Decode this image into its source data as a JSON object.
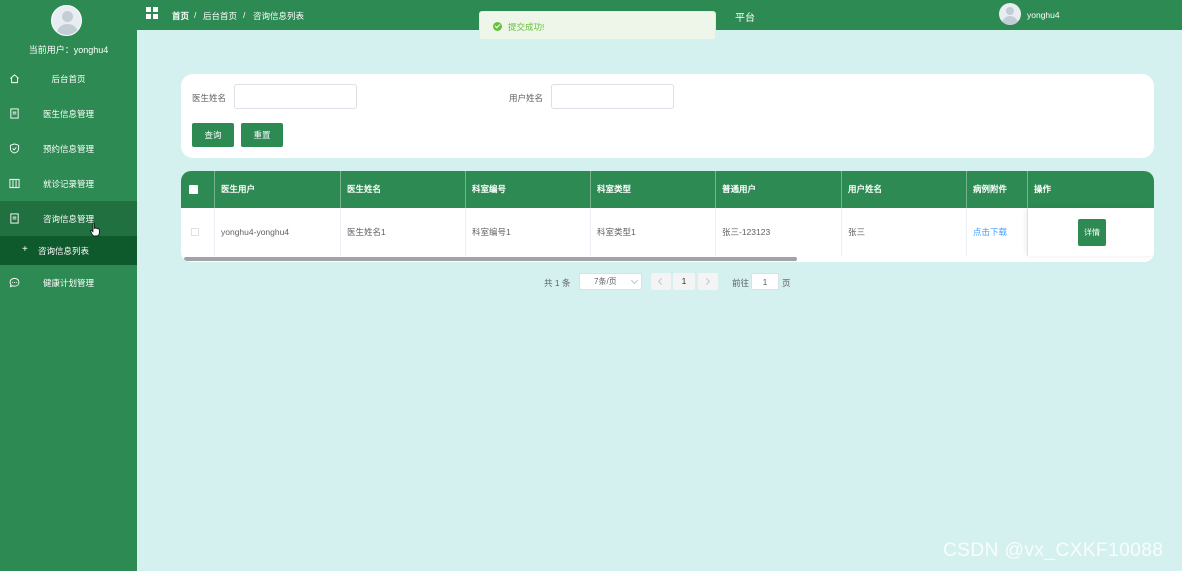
{
  "sidebar": {
    "current_user_label": "当前用户：",
    "current_user": "yonghu4",
    "items": [
      {
        "label": "后台首页",
        "icon": "home-icon"
      },
      {
        "label": "医生信息管理",
        "icon": "document-icon"
      },
      {
        "label": "预约信息管理",
        "icon": "shield-icon"
      },
      {
        "label": "就诊记录管理",
        "icon": "columns-icon"
      },
      {
        "label": "咨询信息管理",
        "icon": "document-icon"
      },
      {
        "label": "健康计划管理",
        "icon": "chat-icon"
      }
    ],
    "submenu": {
      "prefix": "+",
      "label": "咨询信息列表"
    }
  },
  "topbar": {
    "breadcrumbs": [
      "首页",
      "后台首页",
      "咨询信息列表"
    ],
    "separator": "/",
    "site_title": "平台",
    "user": "yonghu4"
  },
  "toast": {
    "message": "提交成功!"
  },
  "search": {
    "doctor_name_label": "医生姓名",
    "doctor_name_value": "",
    "user_name_label": "用户姓名",
    "user_name_value": "",
    "query_label": "查询",
    "reset_label": "重置"
  },
  "table": {
    "columns": [
      "医生用户",
      "医生姓名",
      "科室编号",
      "科室类型",
      "普通用户",
      "用户姓名",
      "病例附件",
      "操作"
    ],
    "rows": [
      {
        "doctor_user": "yonghu4-yonghu4",
        "doctor_name": "医生姓名1",
        "dept_no": "科室编号1",
        "dept_type": "科室类型1",
        "normal_user": "张三-123123",
        "user_name": "张三",
        "attachment": "点击下载",
        "action": "详情"
      }
    ]
  },
  "pagination": {
    "total_text": "共 1 条",
    "page_size": "7条/页",
    "current_page": "1",
    "goto_label": "前往",
    "goto_value": "1",
    "page_suffix": "页"
  },
  "watermark": "CSDN @vx_CXKF10088",
  "colors": {
    "primary": "#2d8a52",
    "sidebar_active": "#21703f",
    "submenu": "#0f5a2c",
    "background": "#d4f0ef",
    "link": "#409eff",
    "success": "#67c23a"
  }
}
